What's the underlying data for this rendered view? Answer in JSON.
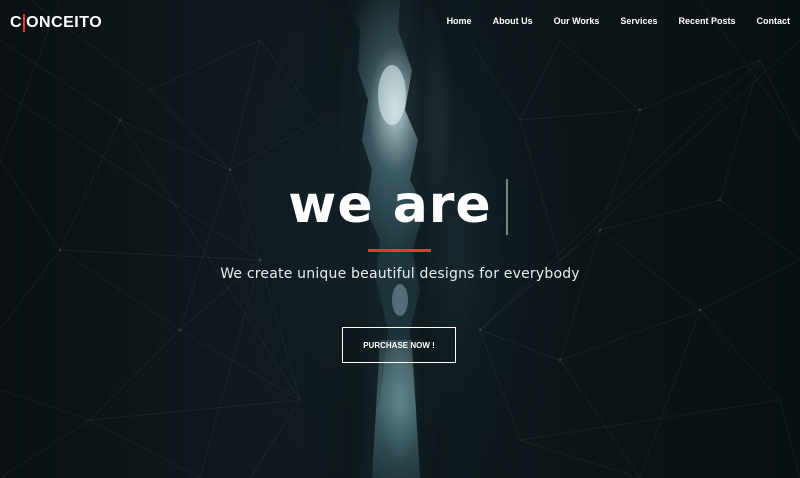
{
  "header": {
    "logo_text_left": "C",
    "logo_text_right": "ONCEITO",
    "nav": [
      {
        "label": "Home"
      },
      {
        "label": "About Us"
      },
      {
        "label": "Our Works"
      },
      {
        "label": "Services"
      },
      {
        "label": "Recent Posts"
      },
      {
        "label": "Contact"
      }
    ]
  },
  "hero": {
    "title": "we are",
    "tagline": "We create unique beautiful designs for everybody",
    "cta_label": "PURCHASE NOW !"
  },
  "colors": {
    "accent": "#e53935",
    "background": "#0b1114",
    "text": "#ffffff"
  }
}
